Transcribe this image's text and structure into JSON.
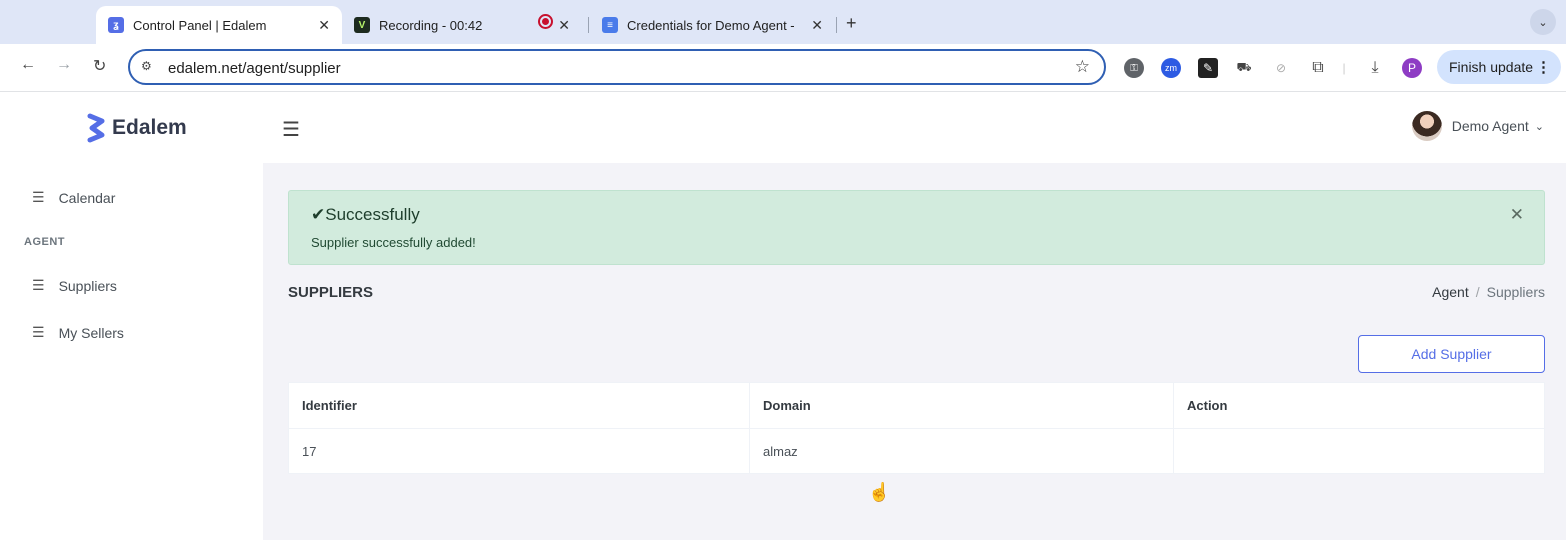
{
  "browser": {
    "tabs": [
      {
        "title": "Control Panel | Edalem",
        "active": true
      },
      {
        "title": "Recording - 00:42",
        "active": false
      },
      {
        "title": "Credentials for Demo Agent -",
        "active": false
      }
    ],
    "url": "edalem.net/agent/supplier",
    "finish_update_label": "Finish update",
    "profile_initial": "P",
    "ext_zm_label": "zm"
  },
  "app": {
    "logo_text": "Edalem",
    "user_name": "Demo Agent",
    "brand_color": "#556ee6"
  },
  "sidebar": {
    "items": [
      {
        "label": "Calendar"
      },
      {
        "label": "Suppliers"
      },
      {
        "label": "My Sellers"
      }
    ],
    "section_title": "AGENT"
  },
  "alert": {
    "title": "✔Successfully",
    "message": "Supplier successfully added!"
  },
  "page": {
    "title": "SUPPLIERS",
    "breadcrumb": {
      "parent": "Agent",
      "current": "Suppliers"
    },
    "add_button_label": "Add Supplier"
  },
  "table": {
    "headers": [
      "Identifier",
      "Domain",
      "Action"
    ],
    "rows": [
      [
        "17",
        "almaz",
        ""
      ]
    ]
  }
}
